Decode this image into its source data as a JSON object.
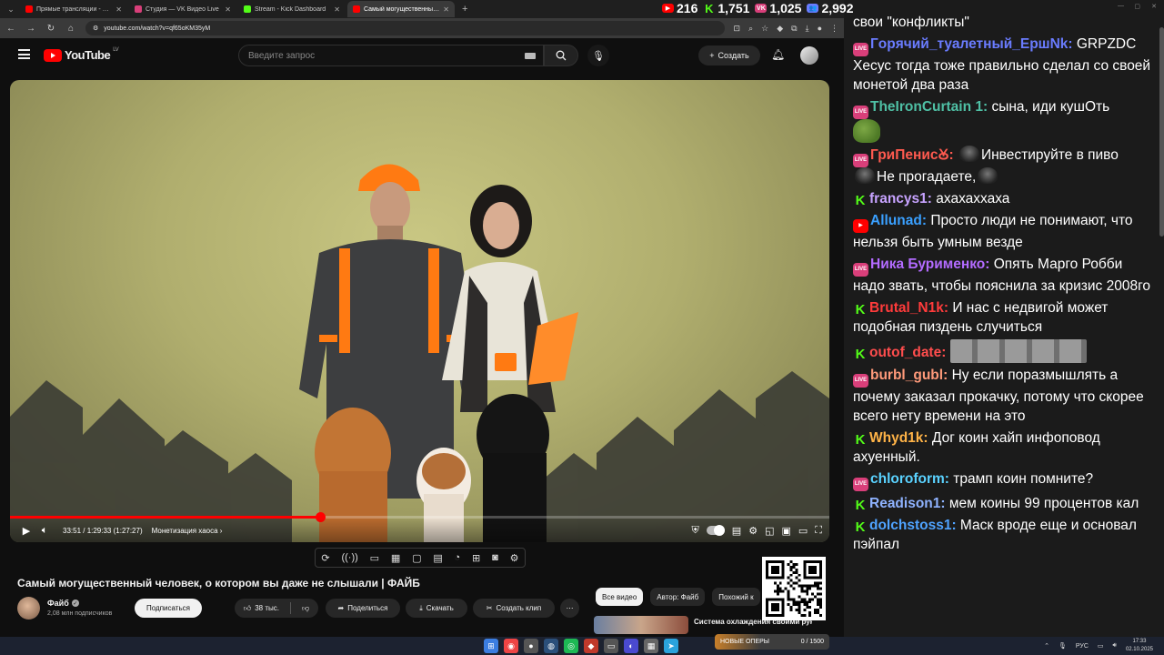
{
  "browser": {
    "tabs": [
      {
        "title": "Прямые трансляции - YouTube",
        "color": "#ff0000",
        "active": false
      },
      {
        "title": "Студия — VK Видео Live",
        "color": "#d93f7a",
        "active": false
      },
      {
        "title": "Stream - Kick Dashboard",
        "color": "#53fc18",
        "active": false
      },
      {
        "title": "Самый могущественный чел...",
        "color": "#ff0000",
        "active": true
      }
    ],
    "url": "youtube.com/watch?v=qf65oKM35yM"
  },
  "stats": [
    {
      "platform": "youtube",
      "count": "216",
      "color": "#ff0000"
    },
    {
      "platform": "kick",
      "count": "1,751",
      "color": "#53fc18"
    },
    {
      "platform": "vk",
      "count": "1,025",
      "color": "#d93f7a"
    },
    {
      "platform": "total",
      "count": "2,992",
      "color": "#6a7cff"
    }
  ],
  "youtube": {
    "logo_text": "YouTube",
    "logo_region": "LV",
    "search_placeholder": "Введите запрос",
    "create_label": "Создать"
  },
  "player": {
    "time": "33:51 / 1:29:33 (1:27:27)",
    "chapter": "Монетизация хаоса",
    "progress_fraction": 0.378
  },
  "video": {
    "title": "Самый могущественный человек, о котором вы даже не слышали | ФАЙБ",
    "channel": "Файб",
    "subscribers": "2,08 млн подписчиков",
    "subscribe_label": "Подписаться",
    "likes": "38 тыс.",
    "share_label": "Поделиться",
    "download_label": "Скачать",
    "clip_label": "Создать клип"
  },
  "related": {
    "chips": [
      "Все видео",
      "Автор: Файб",
      "Похожий к"
    ],
    "first_title": "Система охлаждения своими руками"
  },
  "chat": {
    "messages": [
      {
        "platform": "",
        "user": "",
        "color": "#ffffff",
        "text": "свои \"конфликты\""
      },
      {
        "platform": "vk",
        "user": "Гopячий_туалетный_ЕршNk:",
        "color": "#6a7cff",
        "text": "GRPZDC Хесус тогда тоже правильно сделал со своей монетой два раза"
      },
      {
        "platform": "vk",
        "user": "TheIronCurtain 1:",
        "color": "#4fc0a5",
        "text": "сына, иди кушОть",
        "emote": "pepe"
      },
      {
        "platform": "vk",
        "user": "ГриПенисꙊ:",
        "color": "#ff5a4f",
        "text": "Инвестируйте в пиво",
        "text2": "Не прогадаете,"
      },
      {
        "platform": "kick",
        "user": "francys1:",
        "color": "#c7a3ff",
        "text": "ахахаххаха"
      },
      {
        "platform": "yt",
        "user": "Allunad:",
        "color": "#3aa0ff",
        "text": "Просто люди не понимают, что нельзя быть умным везде"
      },
      {
        "platform": "vk",
        "user": "Ника Бурименко:",
        "color": "#b36bff",
        "text": "Опять Марго Робби надо звать, чтобы пояснила за кризис 2008го"
      },
      {
        "platform": "kick",
        "user": "Brutal_N1k:",
        "color": "#ff3b3b",
        "text": "И нас с недвигой может подобная пиздень случиться"
      },
      {
        "platform": "kick",
        "user": "outof_date:",
        "color": "#ff4d4d",
        "text": "",
        "emote": "wide"
      },
      {
        "platform": "vk",
        "user": "burbl_gubl:",
        "color": "#ff9a7a",
        "text": "Ну если поразмышлять а почему заказал прокачку, потому что скорее всего нету времени на это"
      },
      {
        "platform": "kick",
        "user": "Whyd1k:",
        "color": "#ffb347",
        "text": "Дог коин хайп инфоповод ахуенный."
      },
      {
        "platform": "vk",
        "user": "chloroform:",
        "color": "#5ad2ff",
        "text": "трамп коин помните?"
      },
      {
        "platform": "kick",
        "user": "Readison1:",
        "color": "#8fb3ff",
        "text": "мем коины 99 процентов кал"
      },
      {
        "platform": "kick",
        "user": "dolchstoss1:",
        "color": "#4fa3ff",
        "text": "Маск вроде еще и основал пэйпал"
      }
    ]
  },
  "taskbar": {
    "media_label": "НОВЫЕ ОПЕРЫ",
    "media_count": "0 / 1500",
    "lang": "РУС",
    "time": "17:33",
    "date": "02.10.2025"
  }
}
